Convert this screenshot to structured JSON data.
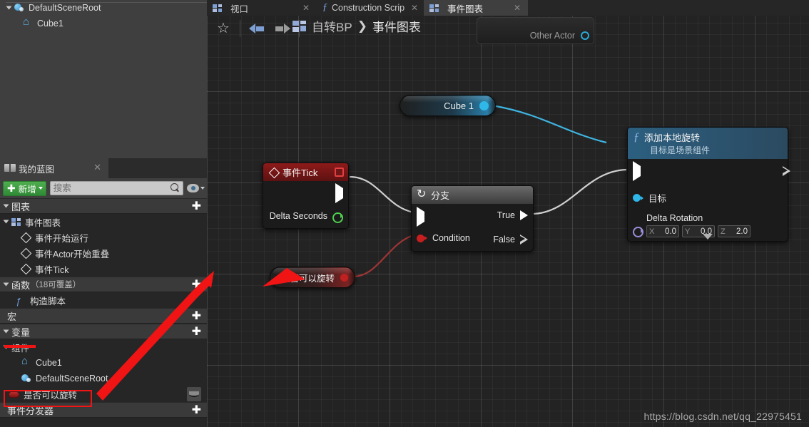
{
  "components_panel": {
    "items": [
      {
        "label": "DefaultSceneRoot",
        "icon": "scene-root-icon",
        "depth": 0
      },
      {
        "label": "Cube1",
        "icon": "cube-icon",
        "depth": 1
      }
    ]
  },
  "mybp_panel": {
    "tab": {
      "label": "我的蓝图",
      "icon": "book-icon",
      "close": "✕"
    },
    "toolbar": {
      "add_new_label": "新增",
      "add_new_plus": "✚",
      "search_placeholder": "搜索",
      "search_value": "",
      "search_icon": "magnify-icon",
      "eye_icon": "eye-icon"
    },
    "sections": [
      {
        "label": "图表",
        "sublabel": "",
        "plus": "✚",
        "rows": [
          {
            "label": "事件图表",
            "icon": "graph-icon",
            "depth": 1,
            "expandable": true
          },
          {
            "label": "事件开始运行",
            "icon": "event-icon",
            "depth": 2
          },
          {
            "label": "事件Actor开始重叠",
            "icon": "event-icon",
            "depth": 2
          },
          {
            "label": "事件Tick",
            "icon": "event-icon",
            "depth": 2
          }
        ]
      },
      {
        "label": "函数",
        "sublabel": "（18可覆盖）",
        "plus": "✚",
        "rows": [
          {
            "label": "构造脚本",
            "icon": "function-icon",
            "depth": 3
          }
        ]
      },
      {
        "label": "宏",
        "sublabel": "",
        "plus": "✚",
        "rows": []
      },
      {
        "label": "变量",
        "sublabel": "",
        "plus": "✚",
        "rows": []
      }
    ],
    "variables": {
      "group_label": "组件",
      "items": [
        {
          "label": "Cube1",
          "icon": "cube-icon"
        },
        {
          "label": "DefaultSceneRoot",
          "icon": "scene-root-icon"
        }
      ],
      "loose": [
        {
          "label": "是否可以旋转",
          "icon": "boolean-icon",
          "visibility_icon": "eye-closed-icon",
          "highlighted": true
        }
      ]
    },
    "event_dispatchers": {
      "label": "事件分发器",
      "plus": "✚"
    }
  },
  "graph": {
    "tabs": [
      {
        "label": "视口",
        "icon": "viewport-icon",
        "active": false,
        "close": "✕"
      },
      {
        "label": "Construction Scrip",
        "icon": "function-icon",
        "active": false,
        "close": "✕"
      },
      {
        "label": "事件图表",
        "icon": "graph-icon",
        "active": true,
        "close": "✕"
      }
    ],
    "toolbar": {
      "bookmark_icon": "star-icon",
      "bookmark_glyph": "☆",
      "back_icon": "arrow-back-icon",
      "forward_icon": "arrow-forward-icon"
    },
    "breadcrumb": {
      "icon": "graph-icon",
      "root": "自转BP",
      "separator": "❯",
      "current": "事件图表"
    },
    "ghost_node": {
      "label": "Other Actor",
      "pin_icon": "delegate-pin-icon"
    },
    "watermark": "https://blog.csdn.net/qq_22975451",
    "nodes": {
      "event_tick": {
        "title": "事件Tick",
        "icon": "event-diamond-icon",
        "exec_out": "",
        "delta_label": "Delta Seconds"
      },
      "branch": {
        "title": "分支",
        "icon": "branch-icon",
        "condition_label": "Condition",
        "true_label": "True",
        "false_label": "False"
      },
      "add_local_rotation": {
        "title": "添加本地旋转",
        "subtitle": "目标是场景组件",
        "icon": "function-f-icon",
        "target_label": "目标",
        "delta_rotation_label": "Delta Rotation",
        "vector": [
          {
            "axis": "X",
            "value": "0.0"
          },
          {
            "axis": "Y",
            "value": "0.0"
          },
          {
            "axis": "Z",
            "value": "2.0"
          }
        ],
        "expander_icon": "chevron-down-icon"
      },
      "cube1_getter": {
        "title": "Cube 1",
        "pin_icon": "object-pin-icon"
      },
      "canrotate_getter": {
        "title": "是否可以旋转",
        "pin_icon": "boolean-pin-icon"
      }
    }
  },
  "colors": {
    "accent_blue": "#2fb7e8",
    "event_red": "#8e1a1a",
    "function_blue": "#2c5f80",
    "annotation_red": "#f01414",
    "add_green": "#4fae4f"
  }
}
